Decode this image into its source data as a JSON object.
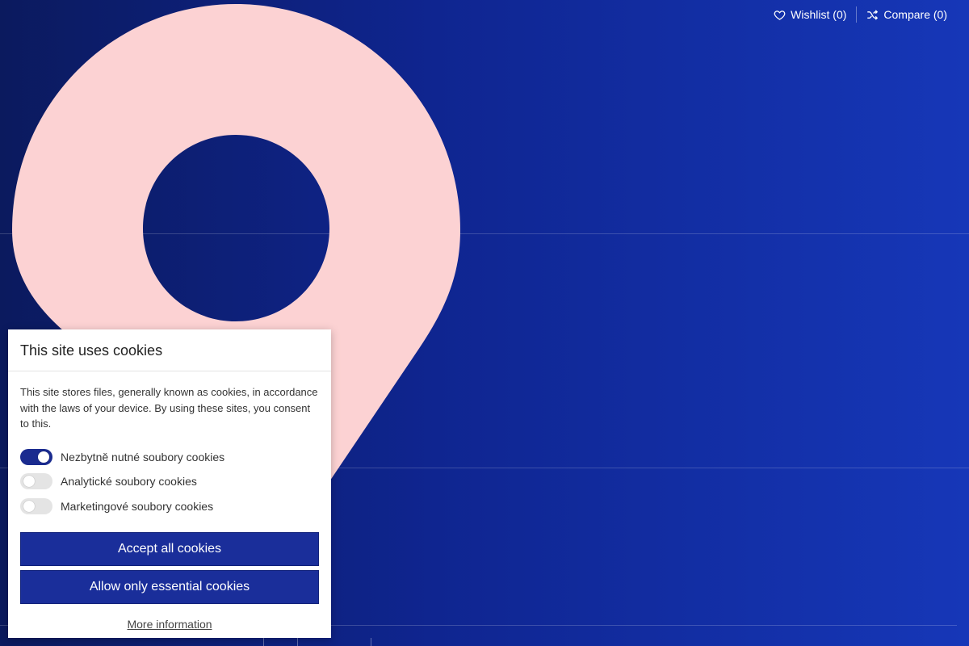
{
  "header": {
    "wishlist_label": "Wishlist (0)",
    "compare_label": "Compare (0)",
    "wishlist_icon": "heart-icon",
    "compare_icon": "shuffle-icon"
  },
  "colors": {
    "background": "#0f2590",
    "pin": "#fcd2d3",
    "accent": "#1a2e9a"
  },
  "cookie_banner": {
    "title": "This site uses cookies",
    "description": "This site stores files, generally known as cookies, in accordance with the laws of your device. By using these sites, you consent to this.",
    "toggles": [
      {
        "label": "Nezbytně nutné soubory cookies",
        "enabled": true
      },
      {
        "label": "Analytické soubory cookies",
        "enabled": false
      },
      {
        "label": "Marketingové soubory cookies",
        "enabled": false
      }
    ],
    "accept_all_label": "Accept all cookies",
    "essential_only_label": "Allow only essential cookies",
    "more_info_label": "More information"
  }
}
